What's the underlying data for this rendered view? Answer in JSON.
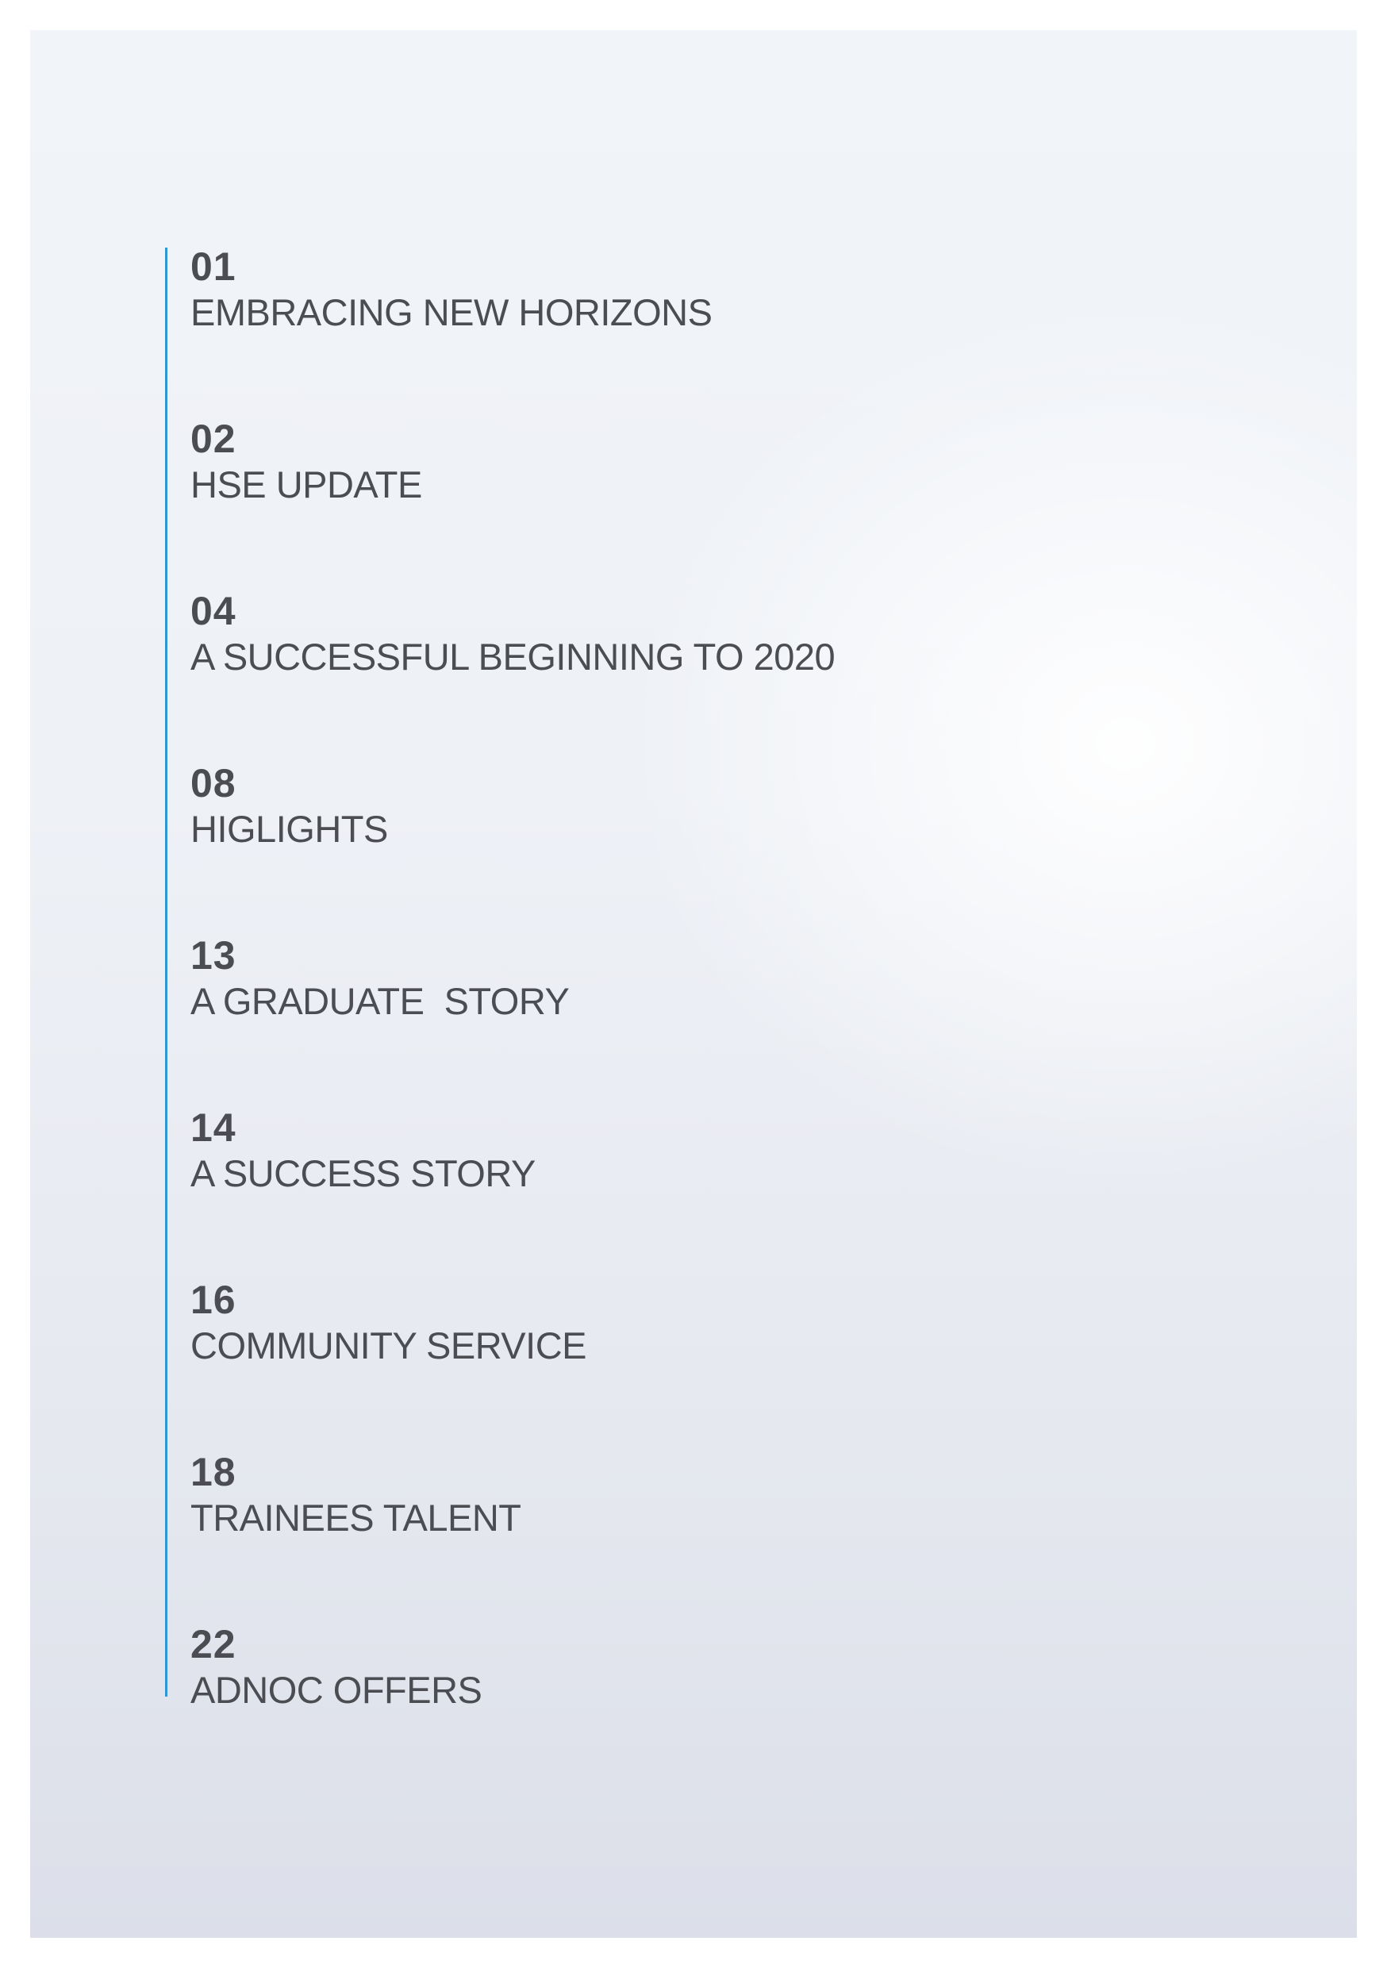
{
  "contents": {
    "accent_color": "#2f95d3",
    "text_color": "#4c4d52",
    "entries": [
      {
        "page": "01",
        "title": "EMBRACING NEW HORIZONS"
      },
      {
        "page": "02",
        "title": "HSE UPDATE"
      },
      {
        "page": "04",
        "title": "A SUCCESSFUL BEGINNING TO 2020"
      },
      {
        "page": "08",
        "title": "HIGLIGHTS"
      },
      {
        "page": "13",
        "title": "A GRADUATE  STORY"
      },
      {
        "page": "14",
        "title": "A SUCCESS STORY"
      },
      {
        "page": "16",
        "title": "COMMUNITY SERVICE"
      },
      {
        "page": "18",
        "title": "TRAINEES TALENT"
      },
      {
        "page": "22",
        "title": "ADNOC OFFERS"
      }
    ]
  }
}
